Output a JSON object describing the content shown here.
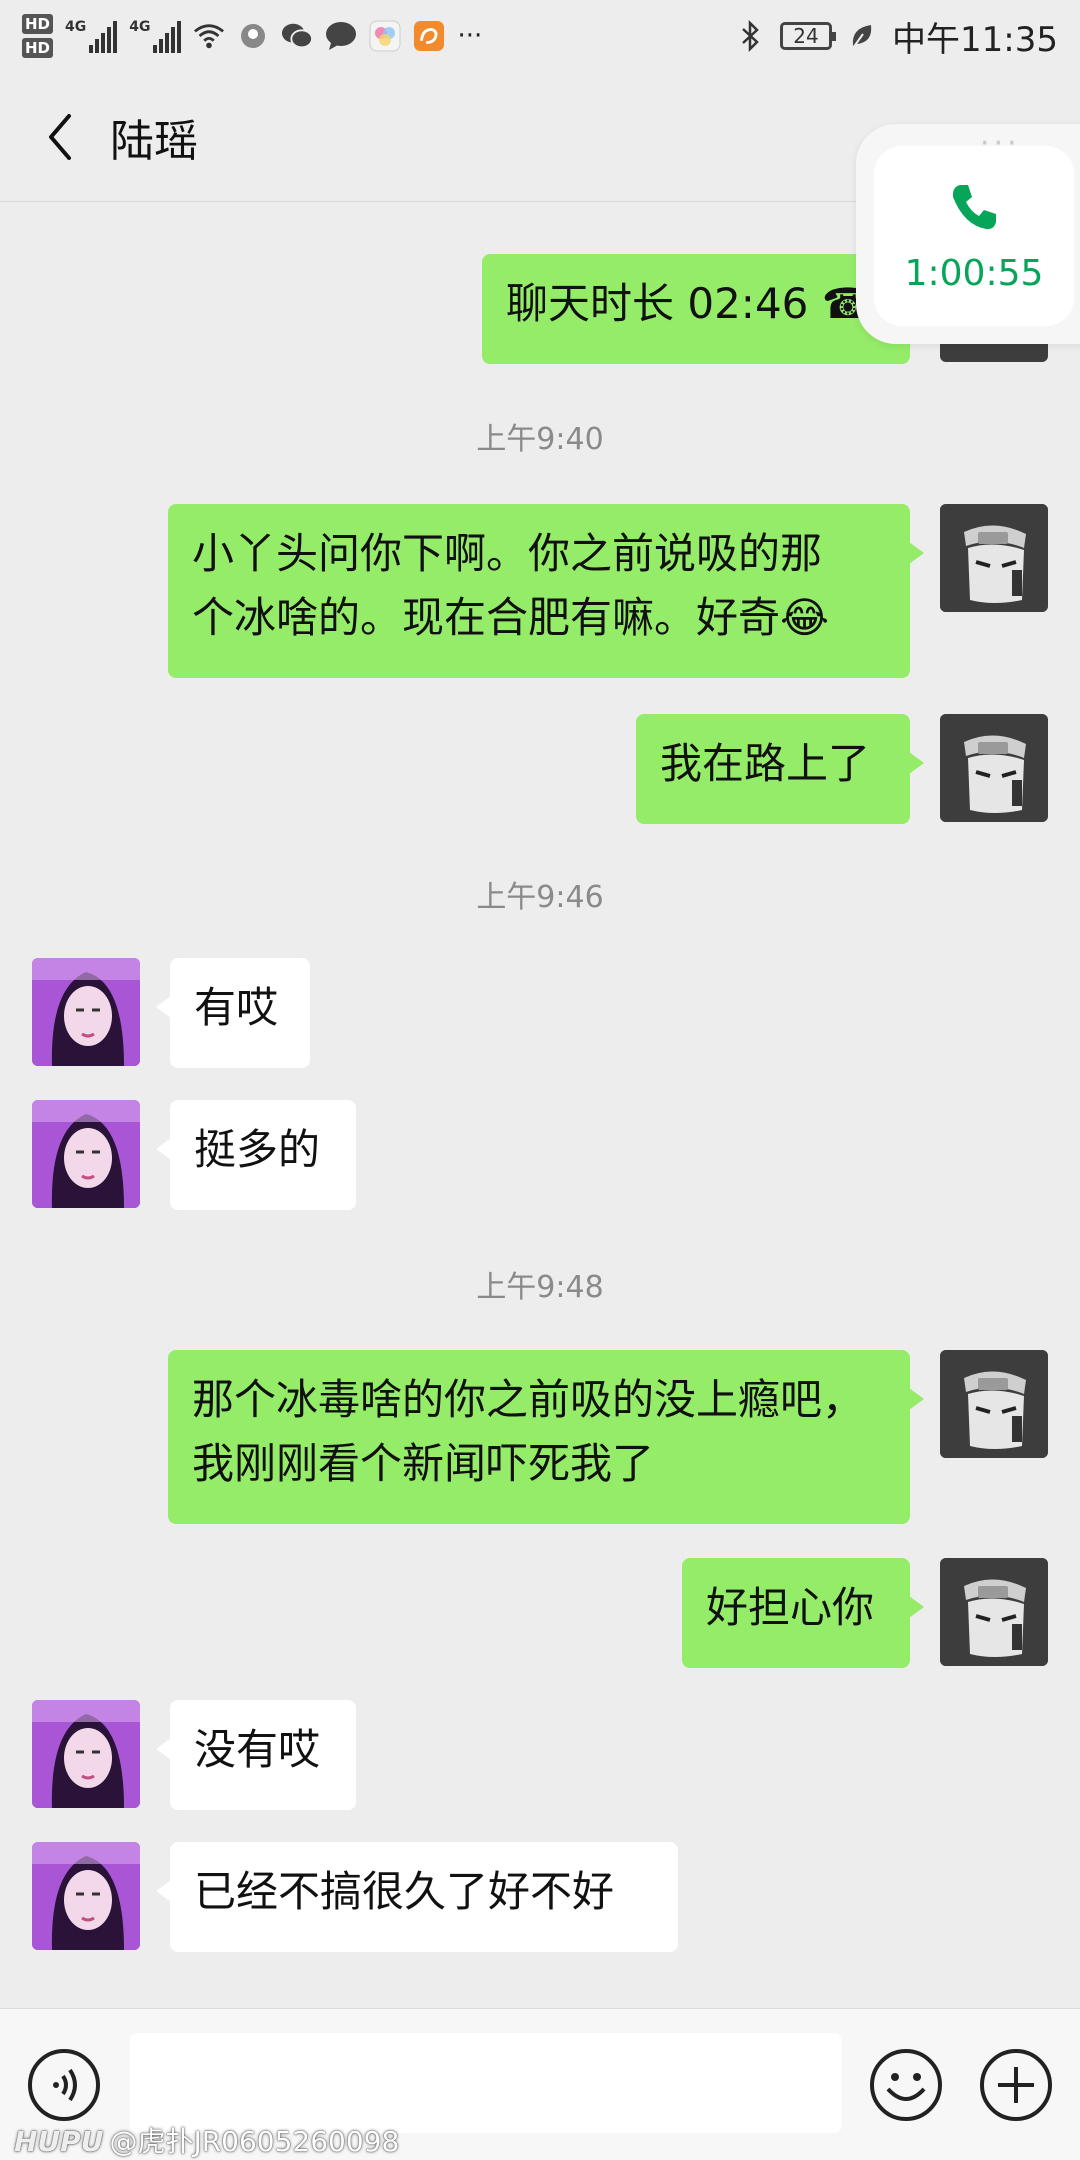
{
  "status_bar": {
    "hd1": "HD",
    "hd2": "HD",
    "net1": "4G",
    "net2": "4G",
    "battery": "24",
    "time": "中午11:35",
    "more": "···"
  },
  "header": {
    "title": "陆瑶"
  },
  "call_widget": {
    "duration": "1:00:55",
    "dots": "···"
  },
  "messages": [
    {
      "type": "out",
      "text": "聊天时长 02:46 ☎"
    },
    {
      "type": "time",
      "text": "上午9:40"
    },
    {
      "type": "out",
      "line1": "小丫头问你下啊。你之前说吸的那",
      "line2": "个冰啥的。现在合肥有嘛。好奇😂"
    },
    {
      "type": "out",
      "text": "我在路上了"
    },
    {
      "type": "time",
      "text": "上午9:46"
    },
    {
      "type": "in",
      "text": "有哎"
    },
    {
      "type": "in",
      "text": "挺多的"
    },
    {
      "type": "time",
      "text": "上午9:48"
    },
    {
      "type": "out",
      "line1": "那个冰毒啥的你之前吸的没上瘾吧，",
      "line2": "我刚刚看个新闻吓死我了"
    },
    {
      "type": "out",
      "text": "好担心你"
    },
    {
      "type": "in",
      "text": "没有哎"
    },
    {
      "type": "in",
      "text": "已经不搞很久了好不好"
    }
  ],
  "input_bar": {
    "value": ""
  },
  "watermark": {
    "brand": "HUPU",
    "text": "@虎扑JR0605260098"
  },
  "colors": {
    "outgoing_bubble": "#95ec69",
    "incoming_bubble": "#ffffff",
    "background": "#ededed",
    "call_green": "#07a55a"
  }
}
